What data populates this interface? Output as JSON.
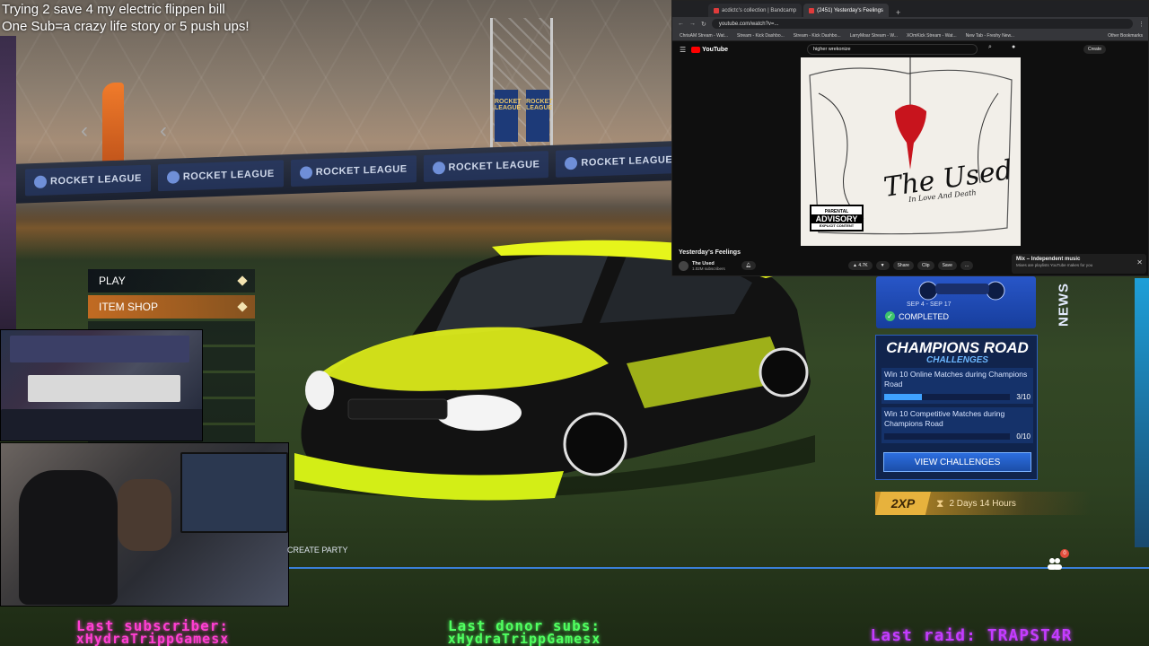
{
  "stream_overlay": {
    "line1": "Trying 2 save 4 my electric flippen bill",
    "line2": "One Sub=a crazy life story or 5 push ups!",
    "last_subscriber_label": "Last subscriber:",
    "last_subscriber_value": "xHydraTrippGamesx",
    "last_donor_label": "Last donor subs:",
    "last_donor_value": "xHydraTrippGamesx",
    "last_raid": "Last raid: TRAPST4R"
  },
  "game": {
    "billboard_text": "ROCKET LEAGUE",
    "pylon_banner": "ROCKET LEAGUE",
    "menu": [
      {
        "label": "PLAY",
        "active": false
      },
      {
        "label": "ITEM SHOP",
        "active": true
      }
    ],
    "news_tab": "NEWS",
    "event": {
      "dates": "SEP 4 - SEP 17",
      "status": "COMPLETED"
    },
    "challenges_panel": {
      "title": "CHAMPIONS ROAD",
      "subtitle": "CHALLENGES",
      "items": [
        {
          "text": "Win 10 Online Matches during Champions Road",
          "progress": 3,
          "total": 10,
          "count": "3/10"
        },
        {
          "text": "Win 10 Competitive Matches during Champions Road",
          "progress": 0,
          "total": 10,
          "count": "0/10"
        }
      ],
      "button": "VIEW CHALLENGES"
    },
    "xp_boost": {
      "badge": "2XP",
      "time_left": "2 Days 14 Hours"
    },
    "create_party": "CREATE PARTY",
    "party_badge": "0",
    "colors": {
      "menu_active": "#c96d22",
      "panel_blue": "#0e2250",
      "progress": "#3fa2ff",
      "car_body": "#101010",
      "car_accent": "#e6f51b"
    }
  },
  "browser": {
    "tabs": [
      {
        "title": "acdictc's collection | Bandcamp",
        "active": false
      },
      {
        "title": "(2451) Yesterday's Feelings",
        "active": true
      }
    ],
    "url": "youtube.com/watch?v=...",
    "bookmarks": [
      "ChrisAM Stream - Wat...",
      "Stream - Kick Dashbo...",
      "Stream - Kick Dashbo...",
      "LarryMoar Stream - W...",
      "XOmKick Stream - Wat...",
      "New Tab - Freshy New..."
    ],
    "other_bookmarks": "Other Bookmarks",
    "youtube": {
      "logo": "YouTube",
      "search_query": "higher wrekonize",
      "create": "Create",
      "video_title": "Yesterday's Feelings",
      "channel": "The Used",
      "subscribers": "1.02M subscribers",
      "likes": "4.7K",
      "actions": [
        "Share",
        "Clip",
        "Save",
        "..."
      ],
      "mix_title": "Mix – Independent music",
      "mix_subtitle": "Mixes are playlists YouTube makes for you"
    },
    "album": {
      "band": "The Used",
      "title": "In Love And Death",
      "advisory_top": "PARENTAL",
      "advisory_mid": "ADVISORY",
      "advisory_bottom": "EXPLICIT CONTENT"
    }
  }
}
